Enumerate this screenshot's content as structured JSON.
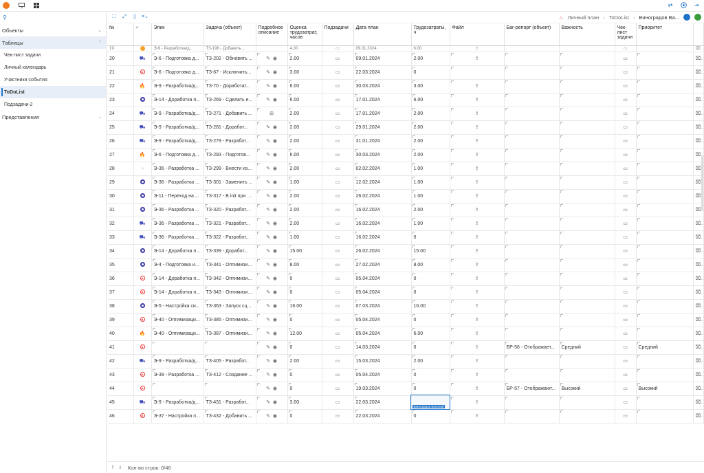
{
  "topbar": {
    "logo_letter": "",
    "icons": [
      "monitor-icon",
      "grid-icon"
    ],
    "right_icons": [
      "swap-icon",
      "help-icon",
      "logout-icon"
    ]
  },
  "sidebar": {
    "groups": [
      {
        "label": "Объекты"
      },
      {
        "label": "Таблицы"
      },
      {
        "label": "Представления"
      }
    ],
    "items": [
      {
        "label": "Чек-лист задачи"
      },
      {
        "label": "Личный календарь"
      },
      {
        "label": "Участники события"
      },
      {
        "label": "ToDoList"
      },
      {
        "label": "Подзадачи-2"
      }
    ]
  },
  "breadcrumb": {
    "home": "Личный план",
    "current": "ToDoList",
    "user": "Виноградов Ва..."
  },
  "table": {
    "headers": [
      "№",
      "",
      "Эпик",
      "Задача (объект)",
      "Подробное описание",
      "Оценка трудозатрат, часов",
      "Подзадачи",
      "Дата план",
      "Трудозатраты, ч",
      "Файл",
      "Баг-репорт (объект)",
      "Важность",
      "Чек-лист задачи",
      "Приоритет",
      ""
    ],
    "rows": [
      {
        "n": "20",
        "st": "truck",
        "epic": "Э-6 - Подготовка д...",
        "task": "ТЗ-202 - Обновить ...",
        "est": "2.00",
        "date": "09.01.2024",
        "labor": "2.00",
        "file": true,
        "bug": "",
        "imp": "",
        "prio": ""
      },
      {
        "n": "21",
        "st": "red",
        "epic": "Э-6 - Подготовка д...",
        "task": "ТЗ-67 - Исключить...",
        "est": "3.00",
        "date": "22.03.2024",
        "labor": "0",
        "file": false,
        "bug": "",
        "imp": "",
        "prio": ""
      },
      {
        "n": "22",
        "st": "fire",
        "epic": "Э-9 - Разработка/д...",
        "task": "ТЗ-70 - Доработат...",
        "est": "6.00",
        "date": "30.03.2024",
        "labor": "3.00",
        "file": true,
        "bug": "",
        "imp": "",
        "prio": ""
      },
      {
        "n": "23",
        "st": "blue",
        "epic": "Э-14 - Доработка п...",
        "task": "ТЗ-269 - Сделать е...",
        "est": "6.00",
        "date": "17.01.2024",
        "labor": "6.00",
        "file": true,
        "bug": "",
        "imp": "",
        "prio": ""
      },
      {
        "n": "24",
        "st": "truck",
        "epic": "Э-9 - Разработка/д...",
        "task": "ТЗ-271 - Добавить ...",
        "est": "2.00",
        "date": "17.01.2024",
        "labor": "2.00",
        "file": true,
        "bug": "",
        "imp": "",
        "prio": ""
      },
      {
        "n": "25",
        "st": "truck",
        "epic": "Э-9 - Разработка/д...",
        "task": "ТЗ-281 - Доработ...",
        "est": "2.00",
        "date": "29.01.2024",
        "labor": "2.00",
        "file": true,
        "bug": "",
        "imp": "",
        "prio": ""
      },
      {
        "n": "26",
        "st": "truck",
        "epic": "Э-9 - Разработка/д...",
        "task": "ТЗ-279 - Разработ...",
        "est": "2.00",
        "date": "31.01.2024",
        "labor": "2.00",
        "file": true,
        "bug": "",
        "imp": "",
        "prio": ""
      },
      {
        "n": "27",
        "st": "fire",
        "epic": "Э-6 - Подготовка д...",
        "task": "ТЗ-293 - Подготов...",
        "est": "6.00",
        "date": "30.03.2024",
        "labor": "2.00",
        "file": true,
        "bug": "",
        "imp": "",
        "prio": ""
      },
      {
        "n": "28",
        "st": "grid",
        "epic": "Э-36 - Разработка ...",
        "task": "ТЗ-299 - Внести из...",
        "est": "2.00",
        "date": "02.02.2024",
        "labor": "1.00",
        "file": true,
        "bug": "",
        "imp": "",
        "prio": ""
      },
      {
        "n": "29",
        "st": "blue",
        "epic": "Э-36 - Разработка ...",
        "task": "ТЗ-301 - Заменить ...",
        "est": "1.00",
        "date": "12.02.2024",
        "labor": "1.00",
        "file": true,
        "bug": "",
        "imp": "",
        "prio": ""
      },
      {
        "n": "30",
        "st": "blue",
        "epic": "Э-11 - Переход на ...",
        "task": "ТЗ-317 - В init при с...",
        "est": "2.00",
        "date": "26.02.2024",
        "labor": "1.00",
        "file": true,
        "bug": "",
        "imp": "",
        "prio": ""
      },
      {
        "n": "31",
        "st": "blue",
        "epic": "Э-36 - Разработка ...",
        "task": "ТЗ-320 - Разработ...",
        "est": "2.00",
        "date": "16.02.2024",
        "labor": "2.00",
        "file": true,
        "bug": "",
        "imp": "",
        "prio": ""
      },
      {
        "n": "32",
        "st": "truck",
        "epic": "Э-36 - Разработка ...",
        "task": "ТЗ-321 - Разработ...",
        "est": "2.00",
        "date": "16.02.2024",
        "labor": "1.00",
        "file": true,
        "bug": "",
        "imp": "",
        "prio": ""
      },
      {
        "n": "33",
        "st": "truck",
        "epic": "Э-36 - Разработка ...",
        "task": "ТЗ-322 - Разработ...",
        "est": "1.00",
        "date": "16.02.2024",
        "labor": "0",
        "file": true,
        "bug": "",
        "imp": "",
        "prio": ""
      },
      {
        "n": "34",
        "st": "blue",
        "epic": "Э-14 - Доработка п...",
        "task": "ТЗ-339 - Доработ...",
        "est": "15.00",
        "date": "26.02.2024",
        "labor": "15.00",
        "file": true,
        "bug": "",
        "imp": "",
        "prio": ""
      },
      {
        "n": "35",
        "st": "blue",
        "epic": "Э-4 - Подготовка и...",
        "task": "ТЗ-341 - Оптимизи...",
        "est": "8.00",
        "date": "27.02.2024",
        "labor": "8.00",
        "file": true,
        "bug": "",
        "imp": "",
        "prio": ""
      },
      {
        "n": "36",
        "st": "red",
        "epic": "Э-14 - Доработка п...",
        "task": "ТЗ-342 - Оптимизи...",
        "est": "0",
        "date": "05.04.2024",
        "labor": "0",
        "file": true,
        "bug": "",
        "imp": "",
        "prio": ""
      },
      {
        "n": "37",
        "st": "red",
        "epic": "Э-14 - Доработка п...",
        "task": "ТЗ-343 - Оптимизи...",
        "est": "0",
        "date": "05.04.2024",
        "labor": "0",
        "file": true,
        "bug": "",
        "imp": "",
        "prio": ""
      },
      {
        "n": "38",
        "st": "blue",
        "epic": "Э-5 - Настройка си...",
        "task": "ТЗ-363 - Запуск сц...",
        "est": "16.00",
        "date": "07.03.2024",
        "labor": "16.00",
        "file": true,
        "bug": "",
        "imp": "",
        "prio": ""
      },
      {
        "n": "39",
        "st": "red",
        "epic": "Э-40 - Оптимизаци...",
        "task": "ТЗ-385 - Оптимизи...",
        "est": "0",
        "date": "05.04.2024",
        "labor": "0",
        "file": true,
        "bug": "",
        "imp": "",
        "prio": ""
      },
      {
        "n": "40",
        "st": "fire",
        "epic": "Э-40 - Оптимизаци...",
        "task": "ТЗ-387 - Оптимизи...",
        "est": "12.00",
        "date": "05.04.2024",
        "labor": "6.00",
        "file": true,
        "bug": "",
        "imp": "",
        "prio": ""
      },
      {
        "n": "41",
        "st": "red",
        "epic": "",
        "task": "",
        "est": "0",
        "date": "14.03.2024",
        "labor": "0",
        "file": true,
        "bug": "БР-56 - Отображает...",
        "imp": "Средний",
        "prio": "Средний"
      },
      {
        "n": "42",
        "st": "truck",
        "epic": "Э-9 - Разработка/д...",
        "task": "ТЗ-405 - Разработ...",
        "est": "2.00",
        "date": "15.03.2024",
        "labor": "2.00",
        "file": true,
        "bug": "",
        "imp": "",
        "prio": ""
      },
      {
        "n": "43",
        "st": "red",
        "epic": "Э-39 - Разработка ...",
        "task": "ТЗ-412 - Создание ...",
        "est": "0",
        "date": "05.04.2024",
        "labor": "0",
        "file": true,
        "bug": "",
        "imp": "",
        "prio": ""
      },
      {
        "n": "44",
        "st": "red",
        "epic": "",
        "task": "",
        "est": "0",
        "date": "19.03.2024",
        "labor": "0",
        "file": true,
        "bug": "БР-57 - Отображают...",
        "imp": "Высокий",
        "prio": "Высокий"
      },
      {
        "n": "45",
        "st": "truck",
        "epic": "Э-9 - Разработка/д...",
        "task": "ТЗ-431 - Разработ...",
        "est": "3.00",
        "date": "22.03.2024",
        "labor": "",
        "file": true,
        "bug": "",
        "imp": "",
        "prio": "",
        "editing": true
      },
      {
        "n": "46",
        "st": "red",
        "epic": "Э-37 - Настройка п...",
        "task": "ТЗ-432 - Добавить ...",
        "est": "0",
        "date": "22.03.2024",
        "labor": "0",
        "file": true,
        "bug": "",
        "imp": "",
        "prio": ""
      }
    ],
    "partial_row": {
      "n": "19",
      "epic": "Э-9 - Разработка/д...",
      "task": "ТЗ-198 - Добавить ...",
      "est": "4.00",
      "date": "09.01.2024",
      "labor": "6.00"
    },
    "editing_user": "Виноградов Василий"
  },
  "footer": {
    "count_label": "Кол-во строк: 0/46"
  }
}
